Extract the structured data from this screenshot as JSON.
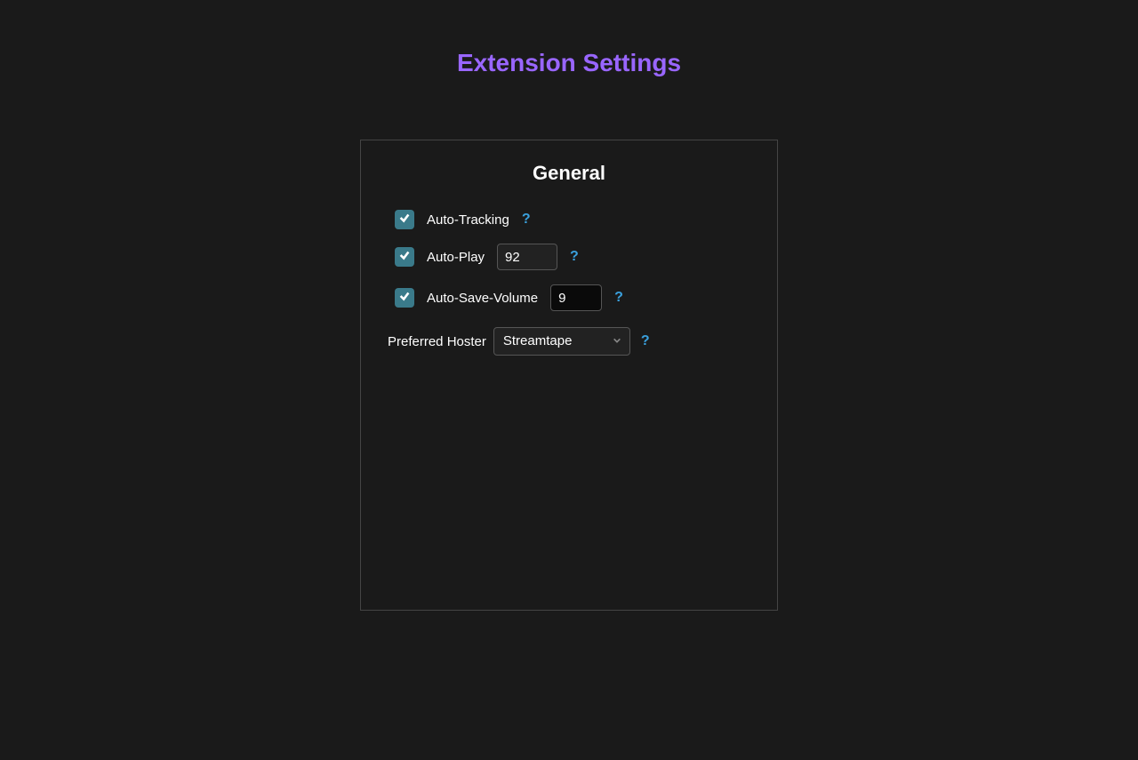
{
  "page": {
    "title": "Extension Settings"
  },
  "panel": {
    "title": "General",
    "auto_tracking": {
      "label": "Auto-Tracking",
      "help": "?"
    },
    "auto_play": {
      "label": "Auto-Play",
      "value": "92",
      "help": "?"
    },
    "auto_save_volume": {
      "label": "Auto-Save-Volume",
      "value": "9",
      "help": "?"
    },
    "preferred_hoster": {
      "label": "Preferred Hoster",
      "value": "Streamtape",
      "help": "?"
    }
  }
}
